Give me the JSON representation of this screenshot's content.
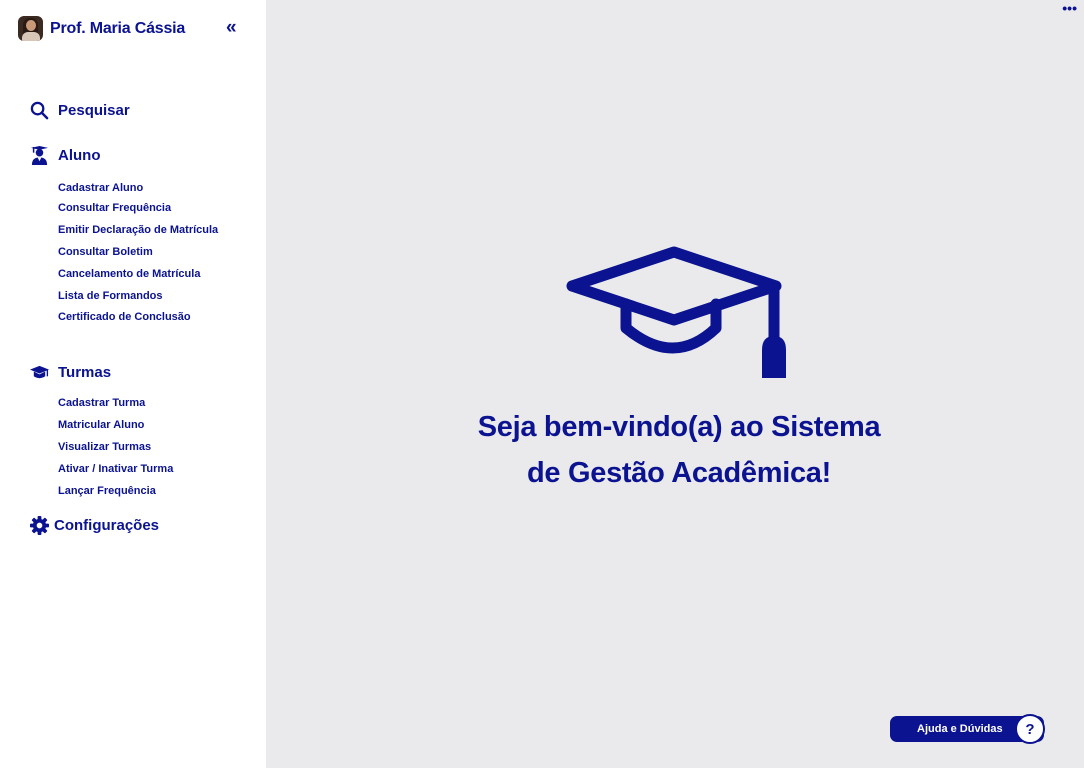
{
  "profile": {
    "name": "Prof. Maria Cássia",
    "avatar_icon": "avatar-photo"
  },
  "collapse_symbol": "«",
  "more_symbol": "•••",
  "sidebar": {
    "search": {
      "label": "Pesquisar",
      "icon": "search-icon"
    },
    "aluno": {
      "label": "Aluno",
      "icon": "student-icon",
      "items": [
        "Cadastrar Aluno",
        "Consultar Frequência",
        "Emitir Declaração de Matrícula",
        "Consultar Boletim",
        "Cancelamento de Matrícula",
        "Lista de Formandos",
        "Certificado de Conclusão"
      ]
    },
    "turmas": {
      "label": "Turmas",
      "icon": "graduation-cap-icon",
      "items": [
        "Cadastrar Turma",
        "Matricular Aluno",
        "Visualizar Turmas",
        "Ativar / Inativar Turma",
        "Lançar Frequência"
      ]
    },
    "config": {
      "label": "Configurações",
      "icon": "gear-icon"
    }
  },
  "main": {
    "hero_icon": "graduation-cap-icon",
    "welcome_line1": "Seja bem-vindo(a) ao Sistema",
    "welcome_line2": "de Gestão Acadêmica!"
  },
  "help": {
    "label": "Ajuda e Dúvidas",
    "symbol": "?"
  },
  "colors": {
    "primary": "#0b1390",
    "sidebar_bg": "#ffffff",
    "main_bg": "#eaeaec"
  }
}
